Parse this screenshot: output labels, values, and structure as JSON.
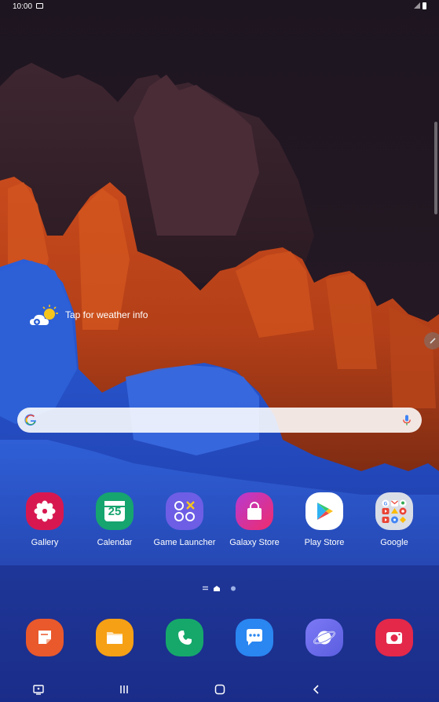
{
  "status_bar": {
    "time": "10:00",
    "notification_icon": "image-notification-icon",
    "signal_icon": "signal-icon",
    "battery_icon": "battery-icon"
  },
  "weather_widget": {
    "icon": "partly-cloudy-add-icon",
    "text": "Tap for weather info"
  },
  "search_bar": {
    "logo_icon": "google-g-icon",
    "mic_icon": "microphone-icon"
  },
  "home_apps": [
    {
      "label": "Gallery",
      "icon": "gallery-flower-icon",
      "color": "#d71850"
    },
    {
      "label": "Calendar",
      "icon": "calendar-icon",
      "day": "25",
      "color": "#16a46f"
    },
    {
      "label": "Game Launcher",
      "icon": "game-launcher-icon",
      "color": "#6d5ee5"
    },
    {
      "label": "Galaxy Store",
      "icon": "shopping-bag-icon",
      "color": "#e2247a"
    },
    {
      "label": "Play Store",
      "icon": "play-store-icon",
      "color": "#ffffff"
    },
    {
      "label": "Google",
      "icon": "google-folder-icon",
      "color": "#d9dde6"
    }
  ],
  "page_indicator": {
    "pages": 2,
    "current": "home"
  },
  "dock_apps": [
    {
      "name": "notes",
      "icon": "notes-icon",
      "color": "#e9592c"
    },
    {
      "name": "my-files",
      "icon": "folder-icon",
      "color": "#f6a015"
    },
    {
      "name": "phone",
      "icon": "phone-icon",
      "color": "#16a86b"
    },
    {
      "name": "messages",
      "icon": "messages-icon",
      "color": "#2a86f1"
    },
    {
      "name": "internet",
      "icon": "internet-planet-icon",
      "color": "#6b6df0"
    },
    {
      "name": "camera",
      "icon": "camera-icon",
      "color": "#e3284a"
    }
  ],
  "nav_bar": {
    "keyboard_icon": "screen-keyboard-icon",
    "recents_icon": "recents-icon",
    "home_icon": "home-icon",
    "back_icon": "back-icon"
  }
}
